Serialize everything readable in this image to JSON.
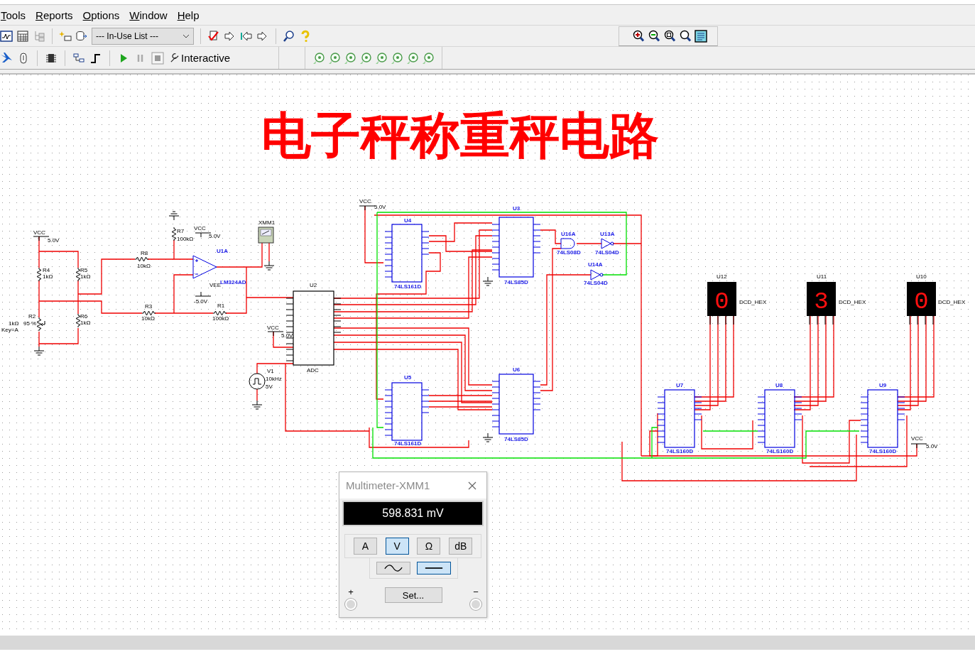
{
  "menu": [
    "Tools",
    "Reports",
    "Options",
    "Window",
    "Help"
  ],
  "toolbar": {
    "component_list": "--- In-Use List ---",
    "simulation_mode": "Interactive"
  },
  "schematic": {
    "title": "电子秤称重秤电路",
    "parts": [
      {
        "kind": "power",
        "labels": [
          "VCC",
          "5.0V"
        ]
      },
      {
        "kind": "resistor",
        "labels": [
          "R4",
          "1kΩ"
        ]
      },
      {
        "kind": "resistor",
        "labels": [
          "R5",
          "1kΩ"
        ]
      },
      {
        "kind": "potentiometer",
        "labels": [
          "R2",
          "1kΩ",
          "95 %",
          "Key=A"
        ]
      },
      {
        "kind": "resistor",
        "labels": [
          "R6",
          "1kΩ"
        ]
      },
      {
        "kind": "ground"
      },
      {
        "kind": "resistor",
        "labels": [
          "R8",
          "10kΩ"
        ]
      },
      {
        "kind": "resistor",
        "labels": [
          "R7",
          "100kΩ"
        ]
      },
      {
        "kind": "ground"
      },
      {
        "kind": "power",
        "labels": [
          "VCC",
          "5.0V"
        ]
      },
      {
        "kind": "opamp",
        "labels": [
          "U1A",
          "LM324AD"
        ]
      },
      {
        "kind": "supply_neg",
        "labels": [
          "VEE",
          "-5.0V"
        ]
      },
      {
        "kind": "resistor",
        "labels": [
          "R3",
          "10kΩ"
        ]
      },
      {
        "kind": "resistor",
        "labels": [
          "R1",
          "100kΩ"
        ]
      },
      {
        "kind": "multimeter",
        "labels": [
          "XMM1"
        ]
      },
      {
        "kind": "ground"
      },
      {
        "kind": "adc",
        "labels": [
          "U2",
          "ADC"
        ]
      },
      {
        "kind": "power",
        "labels": [
          "VCC",
          "5.0V"
        ]
      },
      {
        "kind": "clock_source",
        "labels": [
          "V1",
          "10kHz",
          "5V"
        ]
      },
      {
        "kind": "ground"
      },
      {
        "kind": "power",
        "labels": [
          "VCC",
          "5.0V"
        ]
      },
      {
        "kind": "counter",
        "labels": [
          "U4",
          "74LS161D"
        ]
      },
      {
        "kind": "comparator",
        "labels": [
          "U3",
          "74LS85D"
        ]
      },
      {
        "kind": "and_gate",
        "labels": [
          "U16A",
          "74LS08D"
        ]
      },
      {
        "kind": "inverter",
        "labels": [
          "U13A",
          "74LS04D"
        ]
      },
      {
        "kind": "inverter",
        "labels": [
          "U14A",
          "74LS04D"
        ]
      },
      {
        "kind": "counter",
        "labels": [
          "U5",
          "74LS161D"
        ]
      },
      {
        "kind": "comparator",
        "labels": [
          "U6",
          "74LS85D"
        ]
      },
      {
        "kind": "ground"
      },
      {
        "kind": "ground"
      },
      {
        "kind": "display",
        "labels": [
          "U12",
          "DCD_HEX"
        ],
        "digit": "0"
      },
      {
        "kind": "display",
        "labels": [
          "U11",
          "DCD_HEX"
        ],
        "digit": "3"
      },
      {
        "kind": "display",
        "labels": [
          "U10",
          "DCD_HEX"
        ],
        "digit": "0"
      },
      {
        "kind": "counter",
        "labels": [
          "U7",
          "74LS160D"
        ]
      },
      {
        "kind": "counter",
        "labels": [
          "U8",
          "74LS160D"
        ]
      },
      {
        "kind": "counter",
        "labels": [
          "U9",
          "74LS160D"
        ]
      },
      {
        "kind": "power",
        "labels": [
          "VCC",
          "5.0V"
        ]
      }
    ]
  },
  "multimeter": {
    "title": "Multimeter-XMM1",
    "reading": "598.831 mV",
    "functions": [
      {
        "label": "A",
        "selected": false
      },
      {
        "label": "V",
        "selected": true
      },
      {
        "label": "Ω",
        "selected": false
      },
      {
        "label": "dB",
        "selected": false
      }
    ],
    "modes": [
      {
        "kind": "ac",
        "selected": false
      },
      {
        "kind": "dc",
        "selected": true
      }
    ],
    "terminals": [
      "+",
      "−"
    ],
    "set_button": "Set..."
  }
}
